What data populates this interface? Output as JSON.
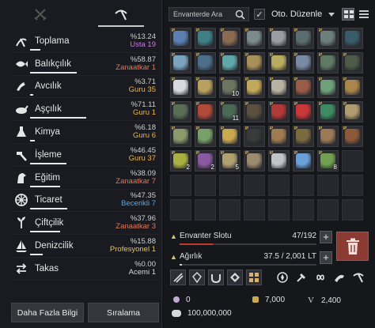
{
  "tabs": [
    {
      "icon": "crossed-swords-icon",
      "active": false
    },
    {
      "icon": "pickaxe-icon",
      "active": true
    }
  ],
  "skills": [
    {
      "name": "Toplama",
      "pct": "%13.24",
      "rank": "Usta 19",
      "rank_color": "#c978e0",
      "progress": 0.13,
      "icon": "gathering-icon"
    },
    {
      "name": "Balıkçılık",
      "pct": "%58.87",
      "rank": "Zanaatkar 1",
      "rank_color": "#e07858",
      "progress": 0.59,
      "icon": "fishing-icon"
    },
    {
      "name": "Avcılık",
      "pct": "%3.71",
      "rank": "Guru 35",
      "rank_color": "#e8b64c",
      "progress": 0.04,
      "icon": "hunting-icon"
    },
    {
      "name": "Aşçılık",
      "pct": "%71.11",
      "rank": "Guru 1",
      "rank_color": "#e8b64c",
      "progress": 0.71,
      "icon": "cooking-icon"
    },
    {
      "name": "Kimya",
      "pct": "%6.18",
      "rank": "Guru 6",
      "rank_color": "#e8b64c",
      "progress": 0.06,
      "icon": "alchemy-icon"
    },
    {
      "name": "İşleme",
      "pct": "%46.45",
      "rank": "Guru 37",
      "rank_color": "#e8b64c",
      "progress": 0.46,
      "icon": "processing-icon"
    },
    {
      "name": "Eğitim",
      "pct": "%38.09",
      "rank": "Zanaatkar 7",
      "rank_color": "#e07858",
      "progress": 0.38,
      "icon": "training-icon"
    },
    {
      "name": "Ticaret",
      "pct": "%47.35",
      "rank": "Becerikli 7",
      "rank_color": "#5aa6e0",
      "progress": 0.47,
      "icon": "trade-icon"
    },
    {
      "name": "Çiftçilik",
      "pct": "%37.96",
      "rank": "Zanaatkar 3",
      "rank_color": "#e07858",
      "progress": 0.38,
      "icon": "farming-icon"
    },
    {
      "name": "Denizcilik",
      "pct": "%15.88",
      "rank": "Profesyonel 1",
      "rank_color": "#e8c45a",
      "progress": 0.16,
      "icon": "sailing-icon"
    },
    {
      "name": "Takas",
      "pct": "%0.00",
      "rank": "Acemi 1",
      "rank_color": "#d8d8d8",
      "progress": 0.0,
      "icon": "barter-icon"
    }
  ],
  "buttons": {
    "more_info": "Daha Fazla Bilgi",
    "ranking": "Sıralama"
  },
  "inventory": {
    "search_placeholder": "Envanterde Ara",
    "auto_sort_label": "Oto. Düzenle",
    "auto_sort_checked": "✓",
    "slots": [
      {
        "color": "#5a7fb0",
        "qty": "",
        "p": true
      },
      {
        "color": "#3f7f86",
        "qty": "",
        "p": true
      },
      {
        "color": "#8a6a52",
        "qty": "",
        "p": true
      },
      {
        "color": "#7b8a8c",
        "qty": "",
        "p": true
      },
      {
        "color": "#9a9ea3",
        "qty": "",
        "p": true
      },
      {
        "color": "#5c6d72",
        "qty": "",
        "p": true
      },
      {
        "color": "#6c7f7a",
        "qty": "",
        "p": true
      },
      {
        "color": "#3a5c6a",
        "qty": "",
        "p": false
      },
      {
        "color": "#7aa3c0",
        "qty": "",
        "p": true
      },
      {
        "color": "#4d6f8a",
        "qty": "",
        "p": true
      },
      {
        "color": "#5fa7a8",
        "qty": "",
        "p": true
      },
      {
        "color": "#a8905a",
        "qty": "",
        "p": true
      },
      {
        "color": "#b8ad5e",
        "qty": "",
        "p": true
      },
      {
        "color": "#7a8aa3",
        "qty": "",
        "p": true
      },
      {
        "color": "#5e7a62",
        "qty": "",
        "p": true
      },
      {
        "color": "#4e5a48",
        "qty": "",
        "p": true
      },
      {
        "color": "#d7dbe0",
        "qty": "",
        "p": true
      },
      {
        "color": "#b8a060",
        "qty": "",
        "p": true
      },
      {
        "color": "#6c7560",
        "qty": "10",
        "p": true
      },
      {
        "color": "#c2a85a",
        "qty": "",
        "p": true
      },
      {
        "color": "#b9b2a0",
        "qty": "",
        "p": true
      },
      {
        "color": "#9a5c4a",
        "qty": "",
        "p": true
      },
      {
        "color": "#6ea07a",
        "qty": "",
        "p": true
      },
      {
        "color": "#a8864c",
        "qty": "",
        "p": true
      },
      {
        "color": "#5a6e55",
        "qty": "",
        "p": true
      },
      {
        "color": "#b24a3a",
        "qty": "",
        "p": true
      },
      {
        "color": "#4a6a55",
        "qty": "11",
        "p": true
      },
      {
        "color": "#5a5040",
        "qty": "",
        "p": true
      },
      {
        "color": "#b23a36",
        "qty": "",
        "p": true
      },
      {
        "color": "#c83838",
        "qty": "",
        "p": true
      },
      {
        "color": "#3e8a62",
        "qty": "",
        "p": true
      },
      {
        "color": "#b09a70",
        "qty": "",
        "p": true
      },
      {
        "color": "#8a9a6a",
        "qty": "",
        "p": true
      },
      {
        "color": "#78a068",
        "qty": "",
        "p": true
      },
      {
        "color": "#c9a850",
        "qty": "",
        "p": true
      },
      {
        "color": "#3a3a3a",
        "qty": "",
        "p": true
      },
      {
        "color": "#a07a50",
        "qty": "",
        "p": true
      },
      {
        "color": "#7a6a40",
        "qty": "",
        "p": true
      },
      {
        "color": "#9c7a58",
        "qty": "",
        "p": true
      },
      {
        "color": "#8a5a3a",
        "qty": "",
        "p": true
      },
      {
        "color": "#aab040",
        "qty": "2",
        "p": true
      },
      {
        "color": "#8a5aa0",
        "qty": "2",
        "p": true
      },
      {
        "color": "#b0a070",
        "qty": "5",
        "p": true
      },
      {
        "color": "#9a8a70",
        "qty": "",
        "p": true
      },
      {
        "color": "#c0c4c8",
        "qty": "",
        "p": true
      },
      {
        "color": "#6aa0d8",
        "qty": "",
        "p": true
      },
      {
        "color": "#70a050",
        "qty": "8",
        "p": true
      },
      {
        "color": "",
        "qty": "",
        "p": false
      }
    ],
    "empty_rows": 2
  },
  "capacity": {
    "slots_label": "Envanter Slotu",
    "slots_value": "47/192",
    "slots_fraction": 0.245,
    "slots_color": "#c0392b",
    "weight_label": "Ağırlık",
    "weight_value": "37.5 / 2,001 LT",
    "weight_fraction": 0.019,
    "weight_color": "#d0d0d0"
  },
  "tools": [
    {
      "icon": "refine-icon",
      "boxed": true
    },
    {
      "icon": "crystal-icon",
      "boxed": true
    },
    {
      "icon": "magnet-icon",
      "boxed": true
    },
    {
      "icon": "alchemy-stone-icon",
      "boxed": true
    },
    {
      "icon": "grid-items-icon",
      "boxed": true
    },
    {
      "icon": "compass-icon",
      "boxed": false
    },
    {
      "icon": "hammer-icon",
      "boxed": false
    },
    {
      "icon": "infinity-icon",
      "boxed": false
    },
    {
      "icon": "workshop-icon",
      "boxed": false
    },
    {
      "icon": "pickaxe-tool-icon",
      "boxed": false
    }
  ],
  "currency": {
    "pearls": "0",
    "seeds": "7,000",
    "value_pack_letter": "V",
    "value_pack": "2,400",
    "silver": "100,000,000"
  }
}
